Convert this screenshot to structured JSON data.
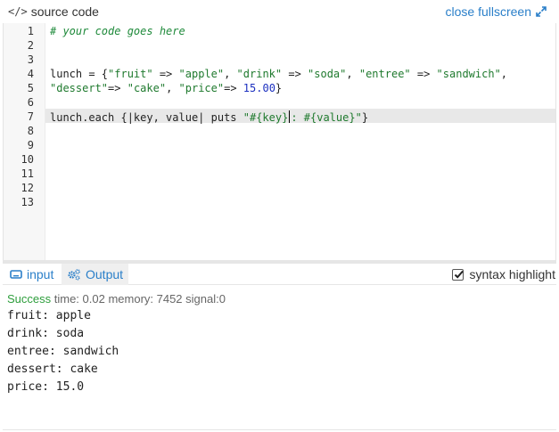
{
  "header": {
    "title": "source code",
    "title_icon": "code-icon",
    "fullscreen_label": "close fullscreen",
    "fullscreen_icon": "expand-arrows-icon"
  },
  "editor": {
    "line_numbers": [
      "1",
      "2",
      "3",
      "4",
      "5",
      "6",
      "7",
      "8",
      "9",
      "10",
      "11",
      "12",
      "13"
    ],
    "active_line": "7",
    "comment": "# your code goes here",
    "line4": {
      "p1": "lunch = {",
      "s1": "\"fruit\"",
      "a1": " => ",
      "s2": "\"apple\"",
      "c1": ", ",
      "s3": "\"drink\"",
      "a2": " => ",
      "s4": "\"soda\"",
      "c2": ", ",
      "s5": "\"entree\"",
      "a3": " => ",
      "s6": "\"sandwich\"",
      "c3": ","
    },
    "line5": {
      "s1": "\"dessert\"",
      "a1": "=> ",
      "s2": "\"cake\"",
      "c1": ", ",
      "s3": "\"price\"",
      "a2": "=> ",
      "n1": "15.00",
      "end": "}"
    },
    "line7": {
      "p1": "lunch.each {|key, value| puts ",
      "s1": "\"#{key}",
      "s2": ": #{value}\"",
      "end": "}"
    }
  },
  "tabs": {
    "input_label": "input",
    "input_icon": "keyboard-icon",
    "output_label": "Output",
    "output_icon": "gears-icon",
    "syntax_label": "syntax highlight",
    "syntax_checked": true
  },
  "output": {
    "status_word": "Success",
    "status_details": " time: 0.02 memory: 7452 signal:0",
    "lines": [
      "fruit: apple",
      "drink: soda",
      "entree: sandwich",
      "dessert: cake",
      "price: 15.0"
    ]
  },
  "colors": {
    "link": "#2a7fc9",
    "success": "#2e9e3c",
    "string": "#1f7a2e",
    "number": "#1b2fbf"
  }
}
